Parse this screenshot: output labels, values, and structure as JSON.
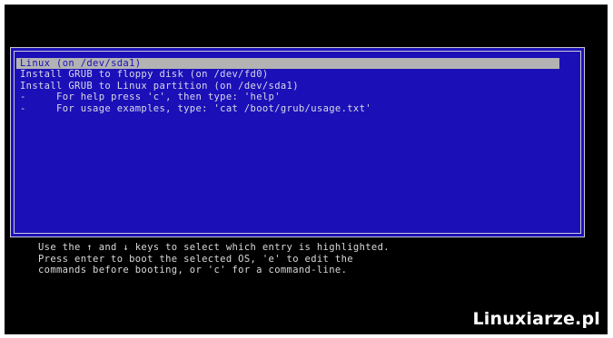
{
  "colors": {
    "screen_background": "#000000",
    "menu_background": "#1b10b8",
    "menu_border": "#c9c9d6",
    "menu_text": "#d9d9e6",
    "selected_background": "#b3b3b3",
    "selected_text": "#1b10b8",
    "help_text": "#d9d9d9",
    "watermark_text": "#ffffff"
  },
  "menu": {
    "selected_index": 0,
    "entries": [
      {
        "label": "Linux (on /dev/sda1)"
      },
      {
        "label": "Install GRUB to floppy disk (on /dev/fd0)"
      },
      {
        "label": "Install GRUB to Linux partition (on /dev/sda1)"
      },
      {
        "label": "-     For help press 'c', then type: 'help'"
      },
      {
        "label": "-     For usage examples, type: 'cat /boot/grub/usage.txt'"
      }
    ]
  },
  "help": {
    "lines": [
      "Use the ↑ and ↓ keys to select which entry is highlighted.",
      "Press enter to boot the selected OS, 'e' to edit the",
      "commands before booting, or 'c' for a command-line."
    ]
  },
  "watermark": {
    "text": "Linuxiarze.pl"
  }
}
